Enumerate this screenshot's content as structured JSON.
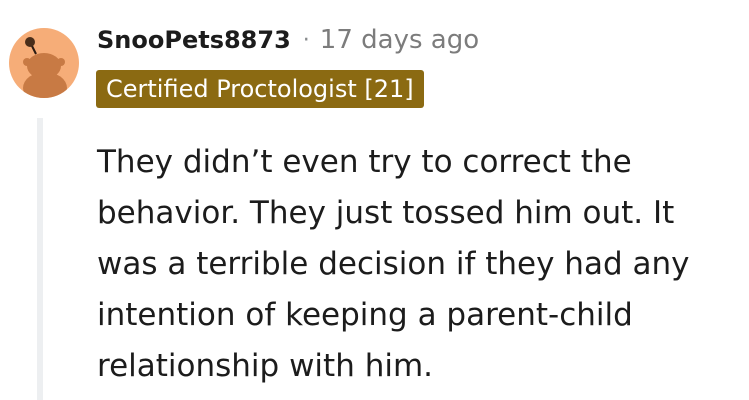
{
  "comment": {
    "author": "SnooPets8873",
    "separator": "·",
    "timestamp": "17 days ago",
    "flair": "Certified Proctologist [21]",
    "body": "They didn’t even try to correct the behavior. They just tossed him out. It was a terrible decision if they had any intention of keeping a parent-child relationship with him."
  },
  "avatar": {
    "icon": "snoo-avatar-icon",
    "background_color": "#f6ad78"
  },
  "colors": {
    "flair_background": "#8b6a12",
    "flair_text": "#ffffff",
    "thread_line": "#edeff1",
    "timestamp": "#7c7c7c"
  }
}
